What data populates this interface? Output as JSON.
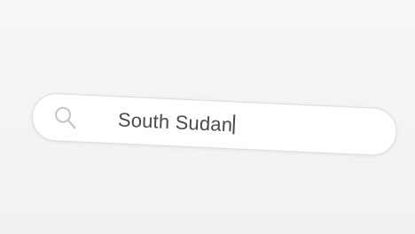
{
  "search": {
    "value": "South Sudan",
    "icon": "search-icon"
  },
  "colors": {
    "background": "#f4f4f6",
    "field": "#ffffff",
    "border": "#dcdcdf",
    "text": "#4a4a4a",
    "icon": "#c4c4c8"
  }
}
